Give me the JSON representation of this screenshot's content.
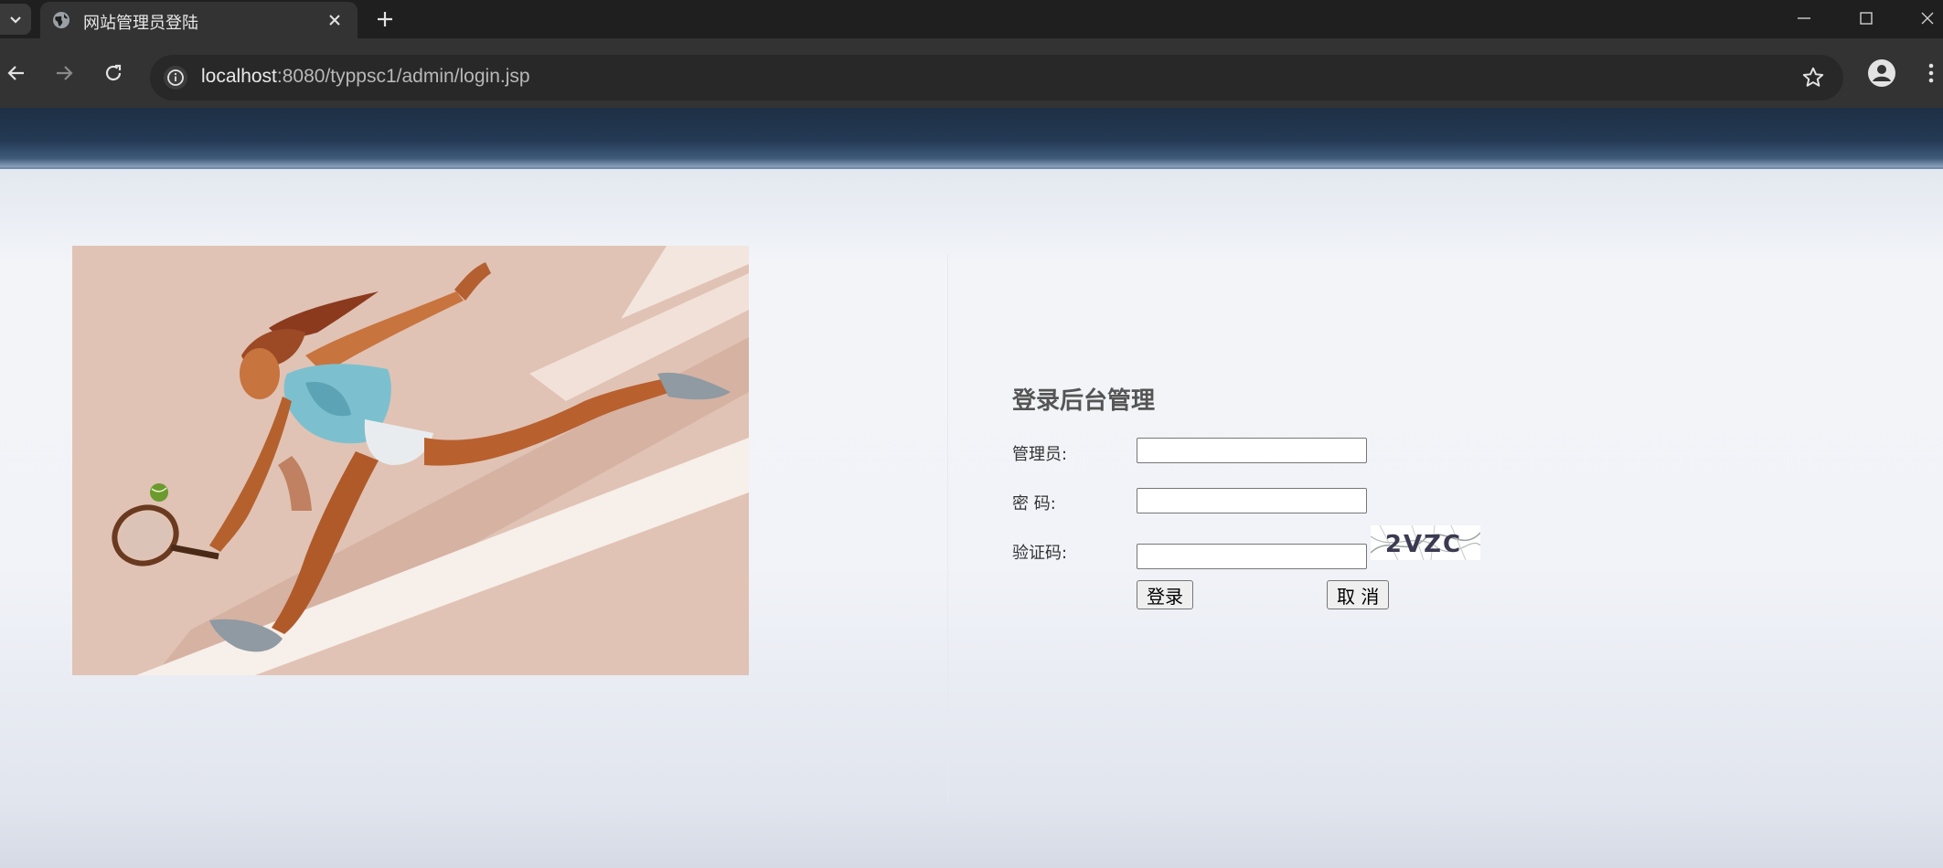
{
  "browser": {
    "tab_title": "网站管理员登陆",
    "url_host": "localhost",
    "url_rest": ":8080/typpsc1/admin/login.jsp",
    "icons": [
      "tab-list-icon",
      "globe-icon",
      "close-icon",
      "plus-icon",
      "minimize-icon",
      "maximize-icon",
      "window-close-icon",
      "back-icon",
      "forward-icon",
      "reload-icon",
      "info-icon",
      "star-icon",
      "profile-icon",
      "menu-icon"
    ]
  },
  "hero": {
    "icon": "tennis-player-illustration",
    "colors": {
      "background": "#e0c3b5"
    }
  },
  "login": {
    "title": "登录后台管理",
    "admin_label": "管理员:",
    "admin_value": "",
    "password_label": "密 码:",
    "password_value": "",
    "captcha_label": "验证码:",
    "captcha_value": "",
    "captcha_text": "2VZC",
    "login_button": "登录",
    "cancel_button": "取 消"
  },
  "theme": {
    "header_color": "#1d2f44",
    "page_background": "#f1f3f8"
  }
}
